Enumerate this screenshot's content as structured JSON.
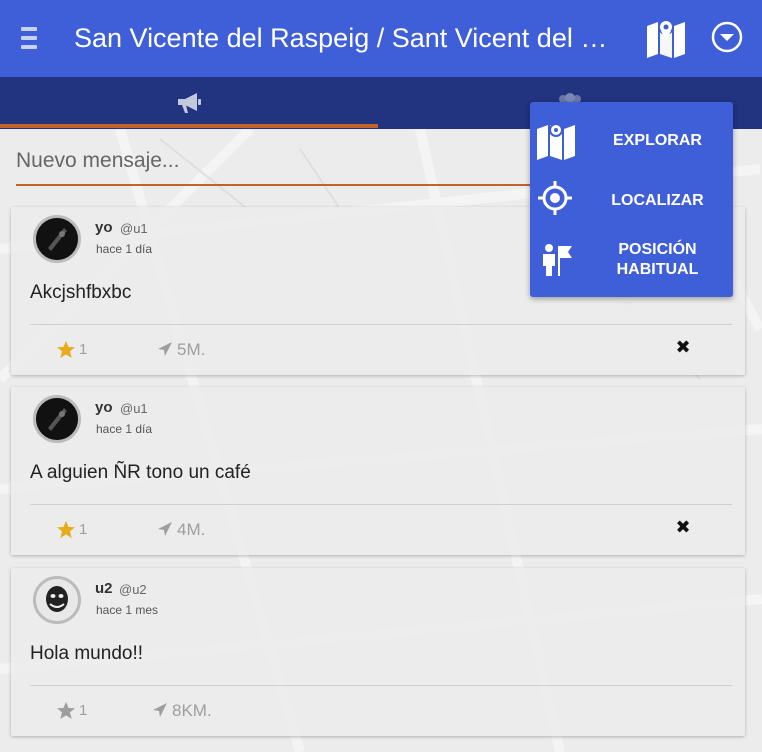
{
  "appbar": {
    "title": "San Vicente del Raspeig / Sant Vicent del Raspeig",
    "menu_icon": "hamburger-icon",
    "map_icon": "map-icon",
    "chevron_icon": "chevron-down-circle-icon"
  },
  "tabs": [
    {
      "icon": "megaphone-icon",
      "active": true
    },
    {
      "icon": "group-icon",
      "active": false
    }
  ],
  "composer": {
    "placeholder": "Nuevo mensaje..."
  },
  "posts": [
    {
      "name": "yo",
      "handle": "@u1",
      "time": "hace 1 día",
      "message": "Akcjshfbxbc",
      "stars": "1",
      "starred": true,
      "distance": "5M.",
      "deletable": true
    },
    {
      "name": "yo",
      "handle": "@u1",
      "time": "hace 1 día",
      "message": "A alguien ÑR tono un café",
      "stars": "1",
      "starred": true,
      "distance": "4M.",
      "deletable": true
    },
    {
      "name": "u2",
      "handle": "@u2",
      "time": "hace 1 mes",
      "message": "Hola mundo!!",
      "stars": "1",
      "starred": false,
      "distance": "8KM.",
      "deletable": false
    }
  ],
  "dropdown": {
    "items": [
      {
        "label": "EXPLORAR",
        "icon": "map-icon"
      },
      {
        "label": "LOCALIZAR",
        "icon": "crosshair-icon"
      },
      {
        "label": "POSICIÓN HABITUAL",
        "icon": "person-flag-icon"
      }
    ]
  },
  "colors": {
    "appbar": "#3f5fd8",
    "tabs": "#223380",
    "accent": "#c4622c",
    "star_active": "#e6ac1c",
    "star_inactive": "#9e9e9e"
  }
}
